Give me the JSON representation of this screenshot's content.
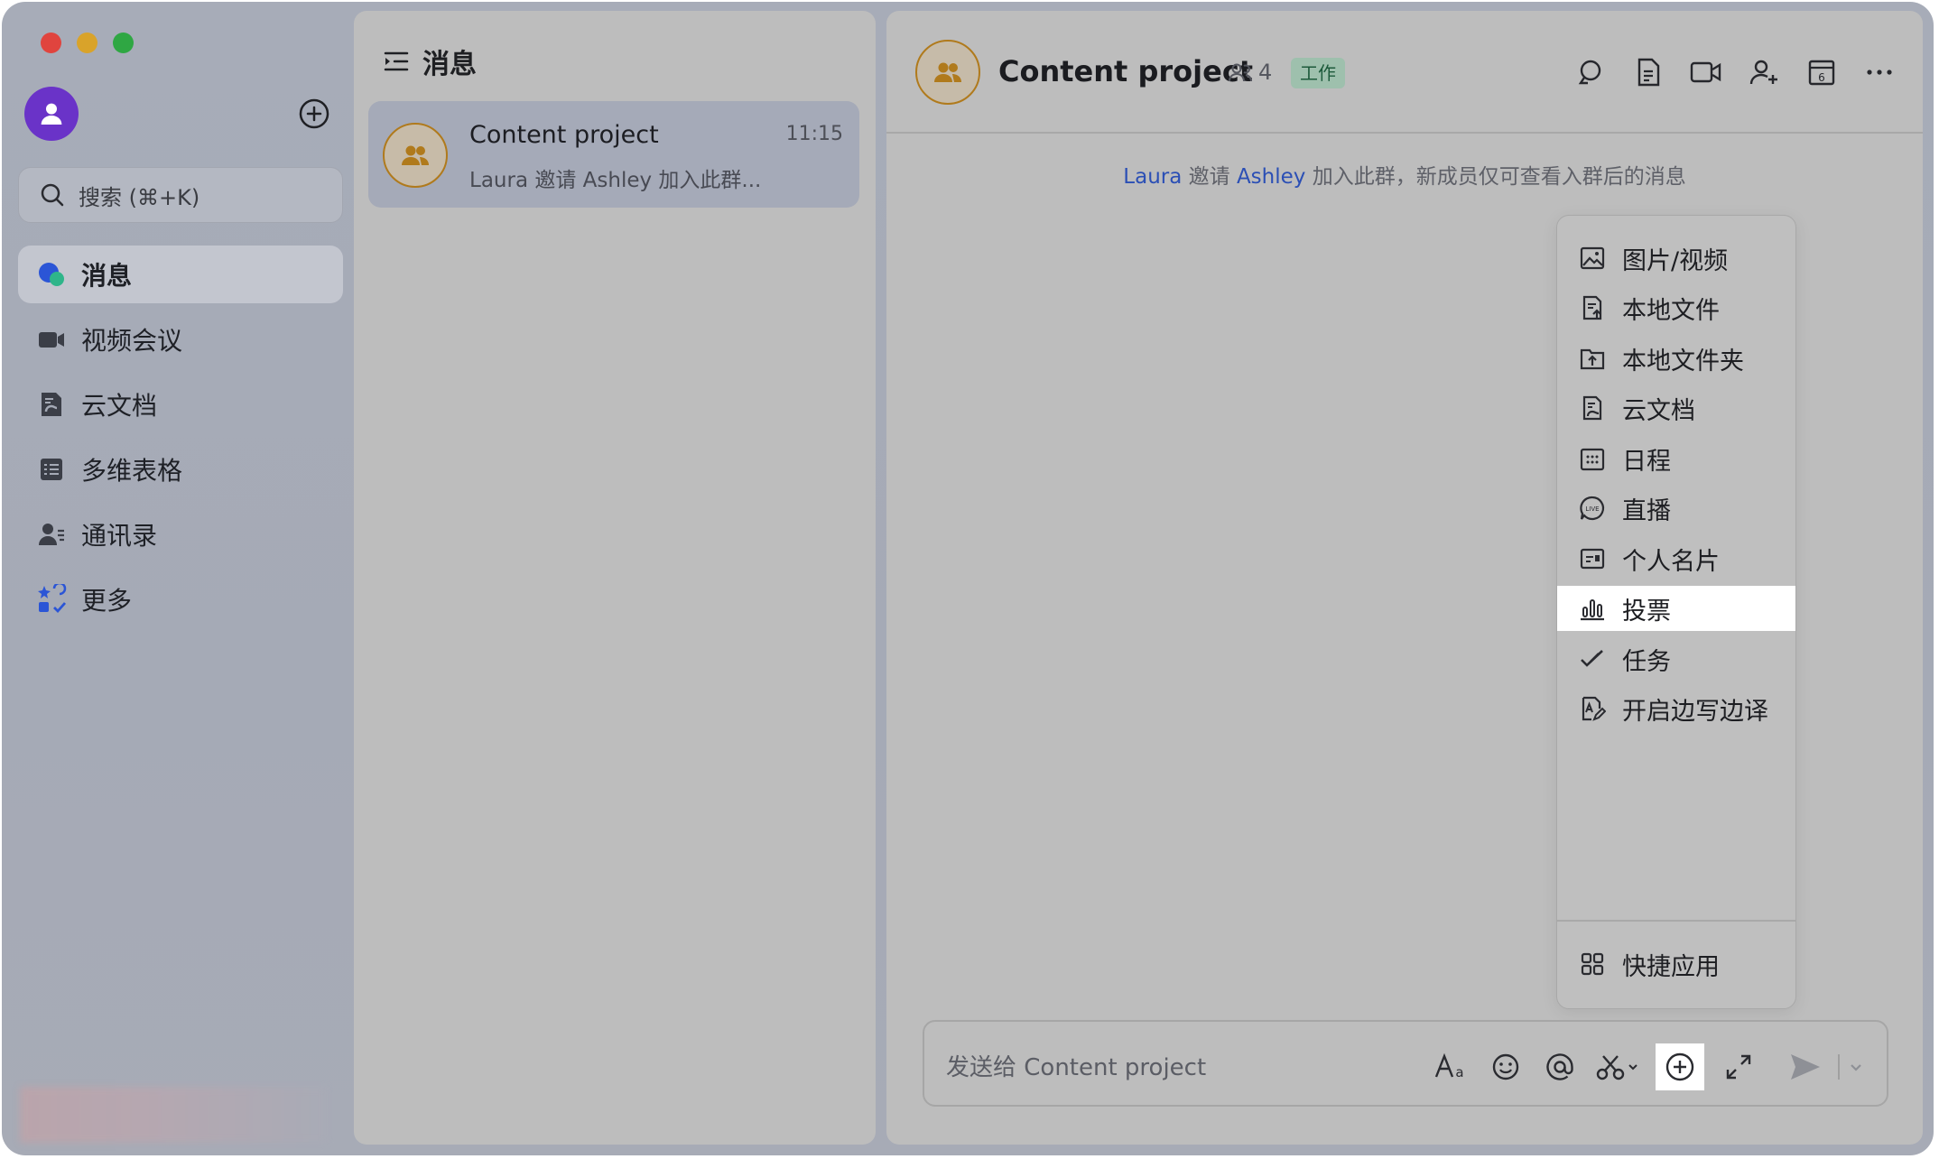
{
  "sidebar": {
    "search_placeholder": "搜索 (⌘+K)",
    "items": [
      {
        "label": "消息",
        "icon": "message-bubble-icon",
        "active": true
      },
      {
        "label": "视频会议",
        "icon": "video-camera-icon"
      },
      {
        "label": "云文档",
        "icon": "cloud-doc-icon"
      },
      {
        "label": "多维表格",
        "icon": "table-icon"
      },
      {
        "label": "通讯录",
        "icon": "contacts-icon"
      },
      {
        "label": "更多",
        "icon": "apps-grid-icon"
      }
    ]
  },
  "conversation_list": {
    "title": "消息",
    "items": [
      {
        "name": "Content project",
        "time": "11:15",
        "preview": "Laura 邀请 Ashley 加入此群..."
      }
    ]
  },
  "chat": {
    "title": "Content project",
    "member_count": "4",
    "tag": "工作",
    "system_message": {
      "inviter": "Laura",
      "verb": "邀请",
      "invitee": "Ashley",
      "suffix": "加入此群，新成员仅可查看入群后的消息"
    },
    "input_placeholder": "发送给 Content project"
  },
  "attach_menu": {
    "items": [
      {
        "label": "图片/视频",
        "icon": "image-icon"
      },
      {
        "label": "本地文件",
        "icon": "file-upload-icon"
      },
      {
        "label": "本地文件夹",
        "icon": "folder-upload-icon"
      },
      {
        "label": "云文档",
        "icon": "cloud-doc-icon"
      },
      {
        "label": "日程",
        "icon": "calendar-icon"
      },
      {
        "label": "直播",
        "icon": "live-icon"
      },
      {
        "label": "个人名片",
        "icon": "contact-card-icon"
      },
      {
        "label": "投票",
        "icon": "poll-icon",
        "highlighted": true
      },
      {
        "label": "任务",
        "icon": "task-check-icon"
      },
      {
        "label": "开启边写边译",
        "icon": "translate-icon"
      }
    ],
    "footer_item": {
      "label": "快捷应用",
      "icon": "quick-apps-icon"
    }
  },
  "colors": {
    "accent_purple": "#6a33c8",
    "link_blue": "#2b4fb5",
    "tag_green": "#9ec0ad",
    "highlight": "#ffffff"
  }
}
